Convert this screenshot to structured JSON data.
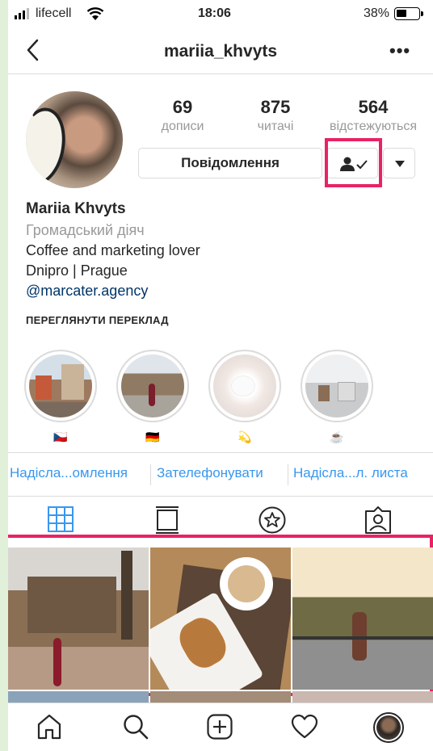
{
  "status_bar": {
    "carrier": "lifecell",
    "time": "18:06",
    "battery": "38%",
    "battery_level": 0.38
  },
  "header": {
    "username": "mariia_khvyts",
    "more": "•••"
  },
  "stats": [
    {
      "value": "69",
      "label": "дописи"
    },
    {
      "value": "875",
      "label": "читачі"
    },
    {
      "value": "564",
      "label": "відстежуються"
    }
  ],
  "buttons": {
    "message": "Повідомлення"
  },
  "bio": {
    "name": "Mariia Khvyts",
    "category": "Громадський діяч",
    "line1": "Coffee and marketing lover",
    "line2": "Dnipro | Prague",
    "link": "@marcater.agency",
    "translate": "ПЕРЕГЛЯНУТИ ПЕРЕКЛАД"
  },
  "stories": [
    {
      "emoji": "🇨🇿"
    },
    {
      "emoji": "🇩🇪"
    },
    {
      "emoji": "💫"
    },
    {
      "emoji": "☕"
    }
  ],
  "actions": [
    "Надісла...омлення",
    "Зателефонувати",
    "Надісла...л. листа"
  ],
  "tabs": [
    "grid-icon",
    "feed-icon",
    "saved-icon",
    "tagged-icon"
  ],
  "bottom_nav": [
    "home-icon",
    "search-icon",
    "add-post-icon",
    "activity-icon",
    "profile-icon"
  ],
  "colors": {
    "accent": "#3897f0",
    "highlight": "#e82364",
    "link": "#003569",
    "muted": "#999999"
  }
}
